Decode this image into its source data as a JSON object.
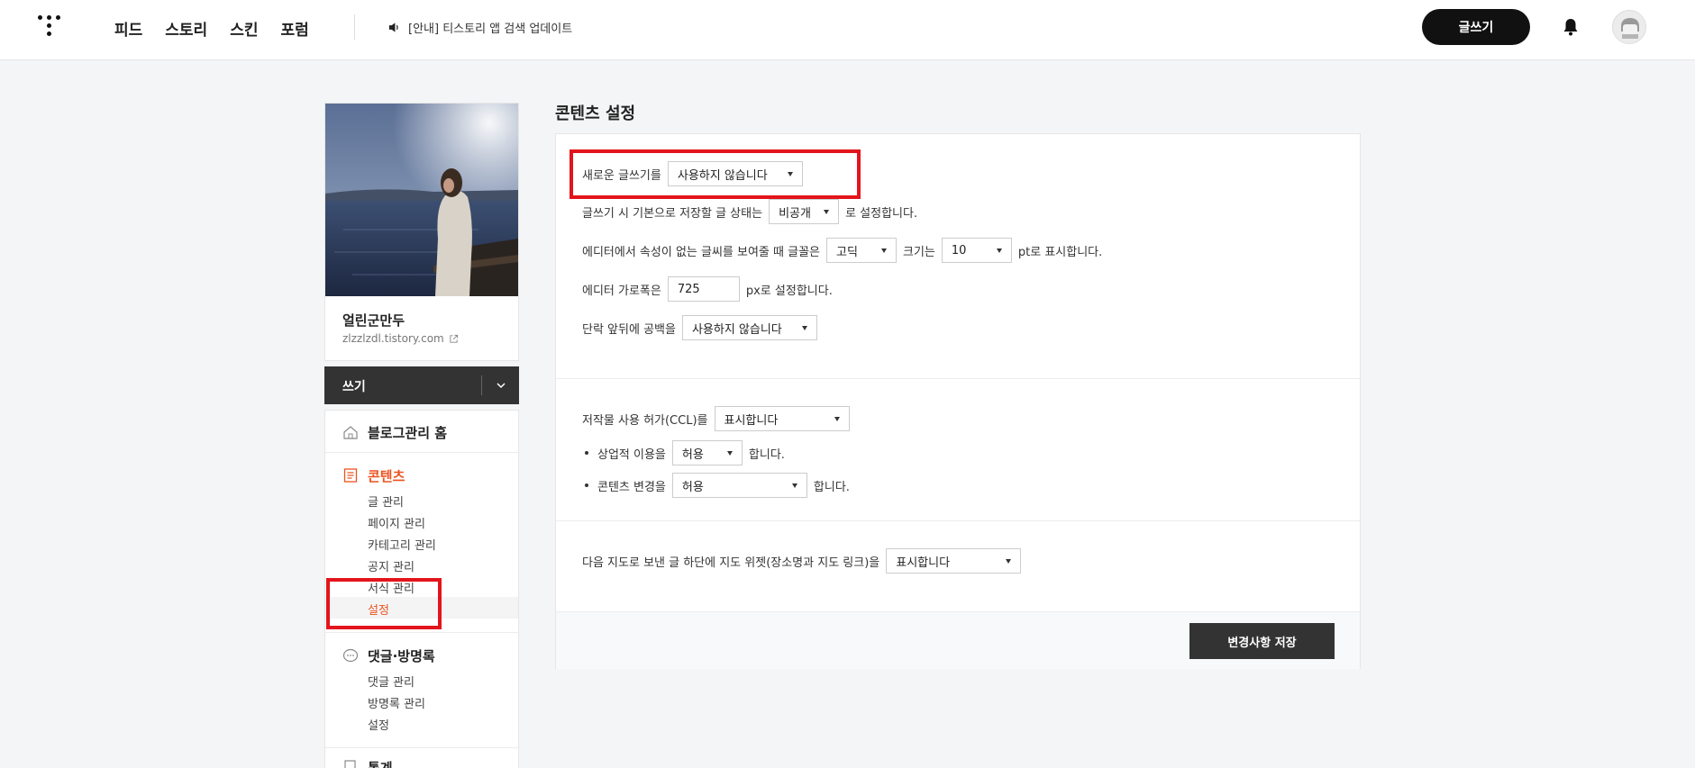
{
  "header": {
    "nav": [
      "피드",
      "스토리",
      "스킨",
      "포럼"
    ],
    "notice": "[안내] 티스토리 앱 검색 업데이트",
    "write_button": "글쓰기"
  },
  "profile": {
    "blog_name": "얼린군만두",
    "blog_url": "zlzzlzdl.tistory.com"
  },
  "write_bar": {
    "label": "쓰기"
  },
  "sidebar": {
    "home": "블로그관리 홈",
    "content_section": {
      "title": "콘텐츠",
      "items": [
        "글 관리",
        "페이지 관리",
        "카테고리 관리",
        "공지 관리",
        "서식 관리",
        "설정"
      ],
      "active_item": "설정"
    },
    "comment_section": {
      "title": "댓글·방명록",
      "items": [
        "댓글 관리",
        "방명록 관리",
        "설정"
      ]
    },
    "stats_section": {
      "title": "통계"
    }
  },
  "main": {
    "title": "콘텐츠 설정",
    "new_editor": {
      "label": "새로운 글쓰기를",
      "value": "사용하지 않습니다"
    },
    "default_status": {
      "prefix": "글쓰기 시 기본으로 저장할 글 상태는",
      "value": "비공개",
      "suffix": "로 설정합니다."
    },
    "font": {
      "prefix": "에디터에서 속성이 없는 글씨를 보여줄 때 글꼴은",
      "font_value": "고딕",
      "mid": "크기는",
      "size_value": "10",
      "suffix": "pt로 표시합니다."
    },
    "editor_width": {
      "prefix": "에디터 가로폭은",
      "value": "725",
      "suffix": "px로 설정합니다."
    },
    "paragraph_space": {
      "prefix": "단락 앞뒤에 공백을",
      "value": "사용하지 않습니다"
    },
    "ccl": {
      "prefix": "저작물 사용 허가(CCL)를",
      "value": "표시합니다"
    },
    "commercial": {
      "prefix": "상업적 이용을",
      "value": "허용",
      "suffix": "합니다."
    },
    "modification": {
      "prefix": "콘텐츠 변경을",
      "value": "허용",
      "suffix": "합니다."
    },
    "map_widget": {
      "prefix": "다음 지도로 보낸 글 하단에 지도 위젯(장소명과 지도 링크)을",
      "value": "표시합니다"
    },
    "save_button": "변경사항 저장"
  },
  "colors": {
    "accent": "#eb531f",
    "highlight": "#e3141c",
    "dark": "#333333"
  }
}
